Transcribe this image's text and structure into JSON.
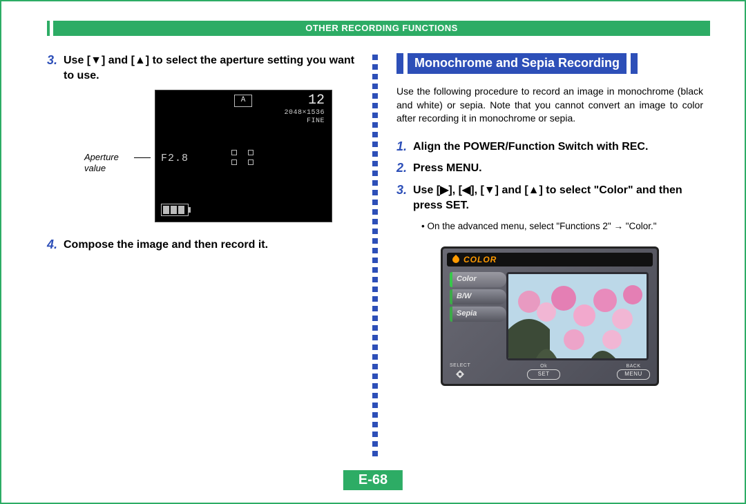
{
  "header": {
    "title": "OTHER RECORDING FUNCTIONS"
  },
  "page_number": "E-68",
  "left": {
    "steps": [
      {
        "num": "3.",
        "text": "Use [▼] and [▲] to select the aperture setting you want to use."
      },
      {
        "num": "4.",
        "text": "Compose the image and then record it."
      }
    ],
    "lcd": {
      "mode_badge": "A",
      "shots_remaining": "12",
      "resolution_line1": "2048×1536",
      "resolution_line2": "FINE",
      "aperture_value": "F2.8",
      "caption": "Aperture value"
    }
  },
  "right": {
    "heading": "Monochrome and Sepia Recording",
    "intro": "Use the following procedure to record an image in monochrome (black and white) or sepia. Note that you cannot convert an image to color after recording it in monochrome or sepia.",
    "steps": [
      {
        "num": "1.",
        "text": "Align the POWER/Function Switch with REC."
      },
      {
        "num": "2.",
        "text": "Press MENU."
      },
      {
        "num": "3.",
        "text": "Use [▶], [◀], [▼] and [▲] to select \"Color\" and then press SET."
      }
    ],
    "bullet": "On the advanced menu, select \"Functions 2\" → \"Color.\"",
    "color_menu": {
      "header": "COLOR",
      "tabs": [
        "Color",
        "B/W",
        "Sepia"
      ],
      "footer": {
        "select_label": "SELECT",
        "ok_label": "Ok",
        "ok_button": "SET",
        "back_label": "BACK",
        "back_button": "MENU"
      }
    }
  }
}
